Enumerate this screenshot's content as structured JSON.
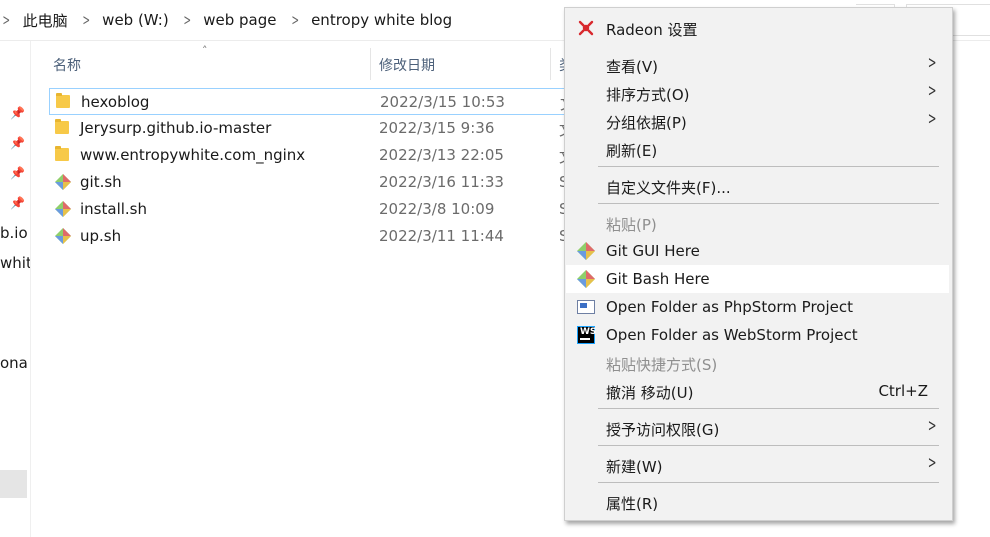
{
  "breadcrumb": {
    "items": [
      "此电脑",
      "web (W:)",
      "web page",
      "entropy white blog"
    ]
  },
  "nav": {
    "partial_labels": [
      "b.io",
      "whit",
      "ona"
    ]
  },
  "columns": {
    "name": "名称",
    "date": "修改日期",
    "type": "类"
  },
  "files": [
    {
      "name": "hexoblog",
      "date": "2022/3/15 10:53",
      "type": "文",
      "icon": "folder-icon",
      "selected": true
    },
    {
      "name": "Jerysurp.github.io-master",
      "date": "2022/3/15 9:36",
      "type": "文",
      "icon": "folder-icon",
      "selected": false
    },
    {
      "name": "www.entropywhite.com_nginx",
      "date": "2022/3/13 22:05",
      "type": "文",
      "icon": "folder-icon",
      "selected": false
    },
    {
      "name": "git.sh",
      "date": "2022/3/16 11:33",
      "type": "S",
      "icon": "git-file-icon",
      "selected": false
    },
    {
      "name": "install.sh",
      "date": "2022/3/8 10:09",
      "type": "S",
      "icon": "git-file-icon",
      "selected": false
    },
    {
      "name": "up.sh",
      "date": "2022/3/11 11:44",
      "type": "S",
      "icon": "git-file-icon",
      "selected": false
    }
  ],
  "context_menu": {
    "radeon": "Radeon 设置",
    "view": "查看(V)",
    "sort": "排序方式(O)",
    "group": "分组依据(P)",
    "refresh": "刷新(E)",
    "customize": "自定义文件夹(F)...",
    "paste": "粘贴(P)",
    "git_gui": "Git GUI Here",
    "git_bash": "Git Bash Here",
    "phpstorm": "Open Folder as PhpStorm Project",
    "webstorm": "Open Folder as WebStorm Project",
    "paste_shortcut": "粘贴快捷方式(S)",
    "undo": "撤消 移动(U)",
    "undo_shortcut": "Ctrl+Z",
    "access": "授予访问权限(G)",
    "new": "新建(W)",
    "properties": "属性(R)",
    "webstorm_icon_text": "WS"
  },
  "colors": {
    "menu_bg": "#f2f2f2",
    "hover_bg": "#ffffff",
    "selection_border": "#99d1ff",
    "folder": "#f7c948",
    "radeon_red": "#d8282e"
  }
}
